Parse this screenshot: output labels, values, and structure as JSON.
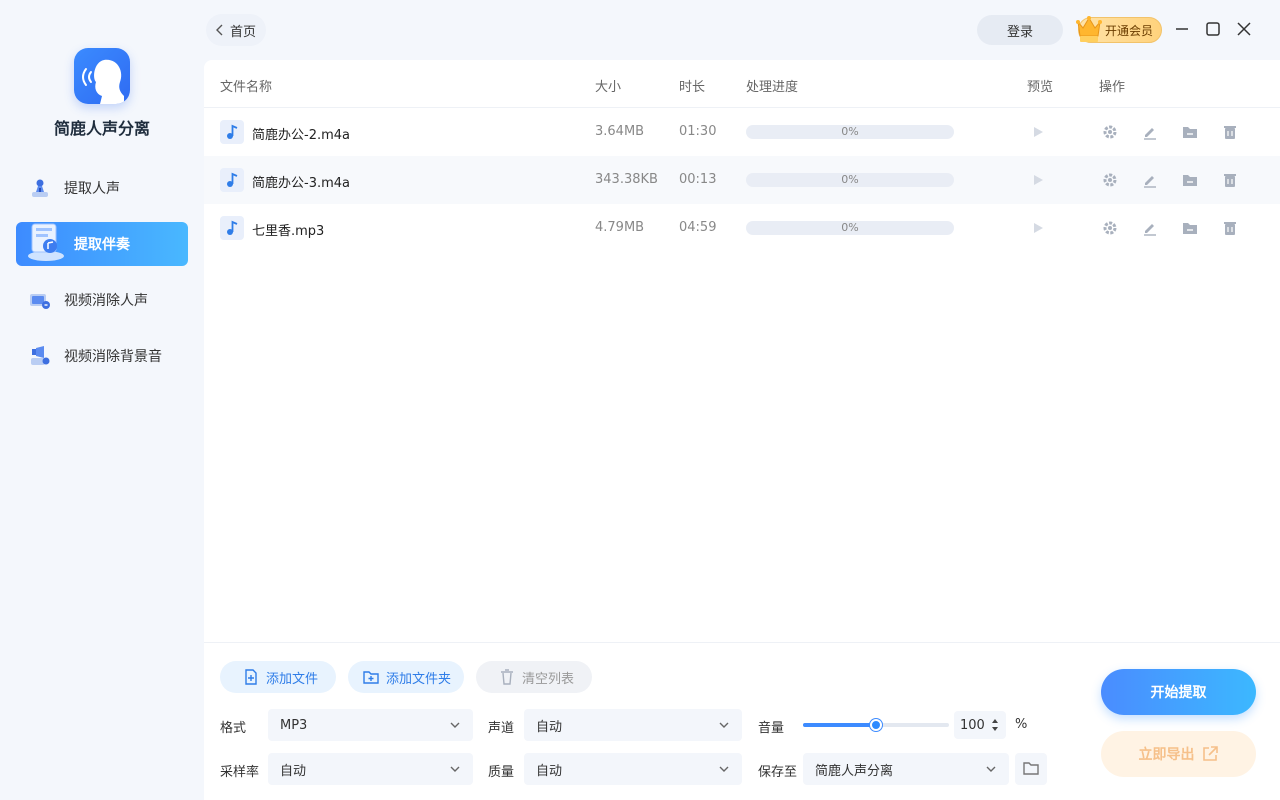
{
  "app": {
    "name": "简鹿人声分离"
  },
  "colors": {
    "accent": "#3d8bff",
    "accent_light": "#49b8ff",
    "vip": "#ffd27c",
    "export_disabled": "#f6c08a"
  },
  "sidebar": {
    "items": [
      {
        "label": "提取人声",
        "icon": "mic-person-icon",
        "active": false
      },
      {
        "label": "提取伴奏",
        "icon": "accompaniment-icon",
        "active": true
      },
      {
        "label": "视频消除人声",
        "icon": "video-voice-icon",
        "active": false
      },
      {
        "label": "视频消除背景音",
        "icon": "video-bg-icon",
        "active": false
      }
    ]
  },
  "topbar": {
    "back_label": "首页",
    "login_label": "登录",
    "vip_label": "开通会员"
  },
  "table": {
    "headers": {
      "name": "文件名称",
      "size": "大小",
      "duration": "时长",
      "progress": "处理进度",
      "preview": "预览",
      "actions": "操作"
    },
    "rows": [
      {
        "name": "简鹿办公-2.m4a",
        "size": "3.64MB",
        "duration": "01:30",
        "progress_label": "0%",
        "progress": 0
      },
      {
        "name": "简鹿办公-3.m4a",
        "size": "343.38KB",
        "duration": "00:13",
        "progress_label": "0%",
        "progress": 0
      },
      {
        "name": "七里香.mp3",
        "size": "4.79MB",
        "duration": "04:59",
        "progress_label": "0%",
        "progress": 0
      }
    ]
  },
  "toolbar": {
    "add_file": "添加文件",
    "add_folder": "添加文件夹",
    "clear_list": "清空列表"
  },
  "settings": {
    "format_label": "格式",
    "format_value": "MP3",
    "channel_label": "声道",
    "channel_value": "自动",
    "samplerate_label": "采样率",
    "samplerate_value": "自动",
    "quality_label": "质量",
    "quality_value": "自动",
    "volume_label": "音量",
    "volume_value": "100",
    "volume_unit": "%",
    "volume_slider": 0.5,
    "save_label": "保存至",
    "save_value": "简鹿人声分离"
  },
  "actions": {
    "start": "开始提取",
    "export": "立即导出"
  }
}
